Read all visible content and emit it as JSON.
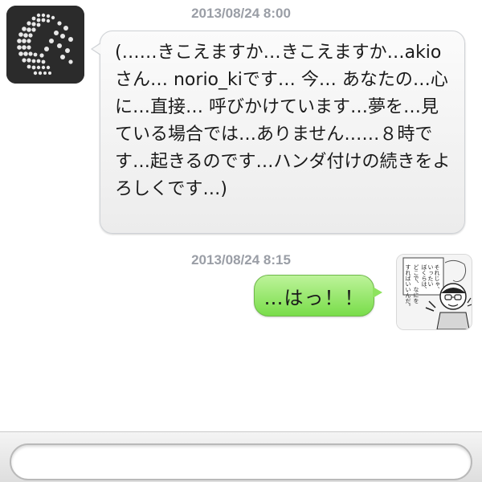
{
  "conversation": {
    "messages": [
      {
        "timestamp": "2013/08/24 8:00",
        "sender": "incoming",
        "text": "(……きこえますか…きこえますか…akioさん… norio_kiです… 今… あなたの…心に…直接… 呼びかけています…夢を…見ている場合では…ありません……８時です…起きるのです…ハンダ付けの続きをよろしくです…)"
      },
      {
        "timestamp": "2013/08/24 8:15",
        "sender": "outgoing",
        "text": "…はっ！！"
      }
    ]
  },
  "avatars": {
    "left_icon": "dot-pattern-avatar-icon",
    "right_icon": "manga-character-avatar-icon",
    "right_caption_lines": [
      "それじゃ、",
      "いったい",
      "ぼくらは、",
      "どこで、なにを",
      "すればいいんだ。"
    ]
  },
  "input": {
    "value": "",
    "placeholder": ""
  },
  "colors": {
    "timestamp": "#9a9ea6",
    "incoming_bubble": "#f2f2f2",
    "outgoing_bubble": "#8ee35e"
  }
}
